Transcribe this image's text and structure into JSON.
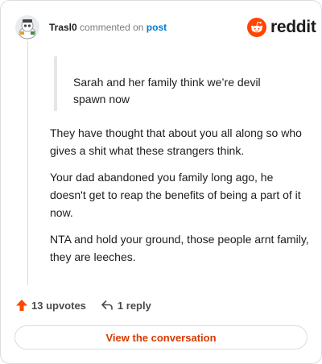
{
  "comment": {
    "username": "Trasl0",
    "action_text": "commented on",
    "post_link": "post",
    "quote": "Sarah and her family think we’re devil spawn now",
    "paragraphs": [
      "They have thought that about you all along so who gives a shit what these strangers think.",
      "Your dad abandoned you family long ago, he doesn't get to reap the benefits of being a part of it now.",
      "NTA and hold your ground, those people arnt family, they are leeches."
    ]
  },
  "brand": {
    "name": "reddit",
    "color": "#ff4500"
  },
  "footer": {
    "upvotes_label": "13 upvotes",
    "reply_label": "1 reply",
    "cta_label": "View the conversation"
  },
  "colors": {
    "upvote": "#ff4500",
    "link": "#0079d3",
    "cta_text": "#d93a00"
  },
  "icons": [
    "avatar",
    "reddit-logo-icon",
    "upvote-arrow-icon",
    "reply-icon"
  ]
}
